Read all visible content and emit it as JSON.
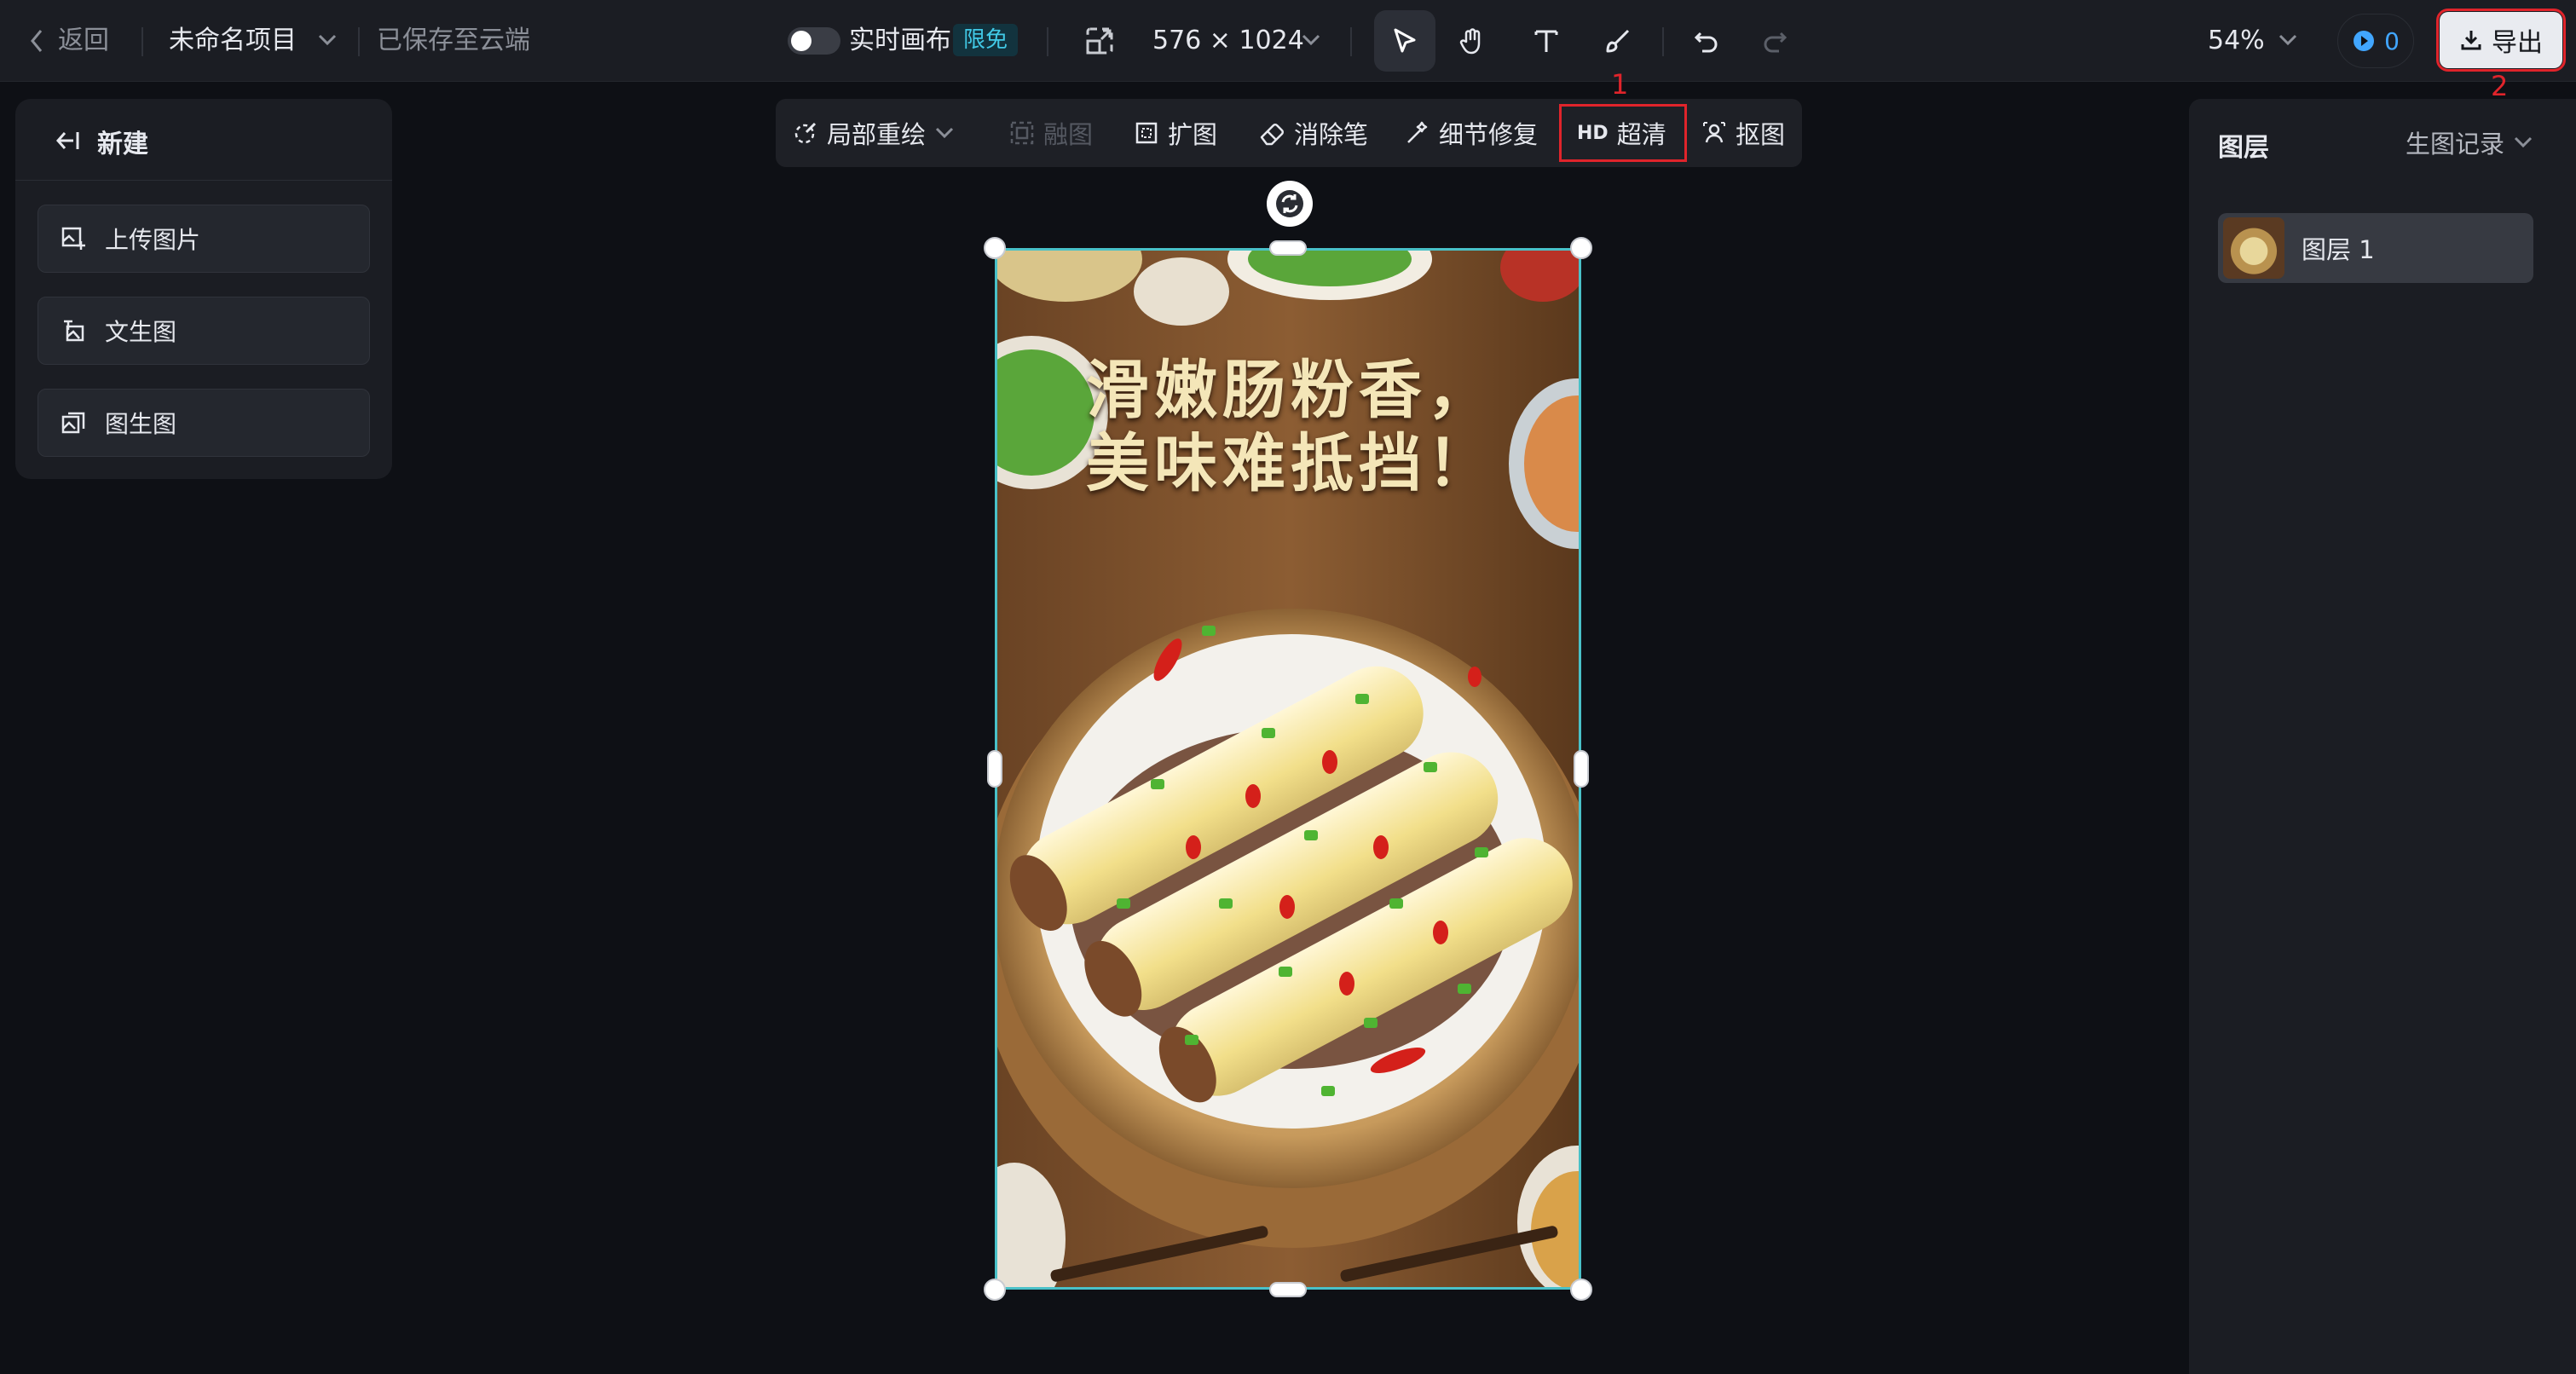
{
  "topbar": {
    "back_label": "返回",
    "project_name": "未命名项目",
    "save_status": "已保存至云端",
    "realtime_label": "实时画布",
    "limited_free_badge": "限免",
    "canvas_size": "576 × 1024",
    "zoom": "54%",
    "credits": "0",
    "export_label": "导出"
  },
  "annotations": {
    "hd_marker": "1",
    "export_marker": "2"
  },
  "left_panel": {
    "new_label": "新建",
    "items": [
      {
        "label": "上传图片",
        "icon": "upload-image-icon"
      },
      {
        "label": "文生图",
        "icon": "text-to-image-icon"
      },
      {
        "label": "图生图",
        "icon": "image-to-image-icon"
      }
    ]
  },
  "sub_toolbar": {
    "inpaint_label": "局部重绘",
    "blend_label": "融图",
    "expand_label": "扩图",
    "eraser_label": "消除笔",
    "detail_fix_label": "细节修复",
    "hd_badge": "HD",
    "hd_label": "超清",
    "cutout_label": "抠图"
  },
  "right_panel": {
    "layers_title": "图层",
    "history_label": "生图记录",
    "layers": [
      {
        "name": "图层 1"
      }
    ]
  },
  "poster": {
    "line1": "滑嫩肠粉香，",
    "line2": "美味难抵挡！"
  },
  "colors": {
    "accent": "#41c9e6",
    "selection": "#49c1c8",
    "annotation": "#e0242b",
    "export_bg": "#e9ebf0"
  }
}
